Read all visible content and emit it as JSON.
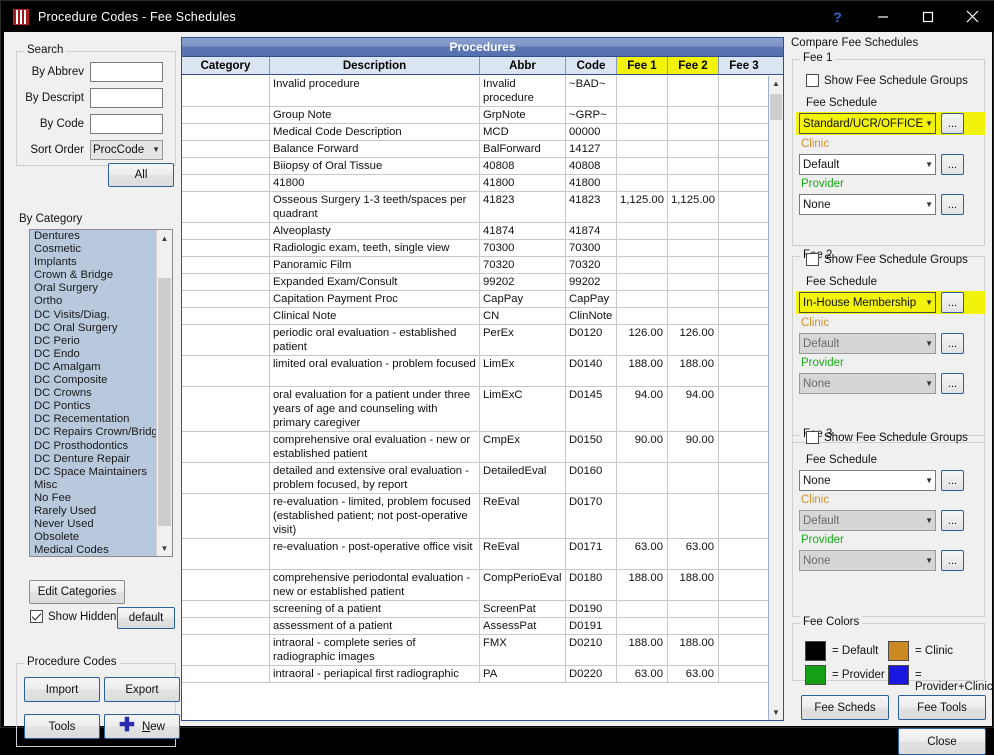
{
  "window": {
    "title": "Procedure Codes - Fee Schedules",
    "buttons": {
      "help": "?",
      "minimize": "minimize-icon",
      "maximize": "maximize-icon",
      "close": "close-icon"
    }
  },
  "search": {
    "legend": "Search",
    "by_abbrev_label": "By Abbrev",
    "by_abbrev_value": "",
    "by_descript_label": "By Descript",
    "by_descript_value": "",
    "by_code_label": "By Code",
    "by_code_value": "",
    "sort_order_label": "Sort Order",
    "sort_order_value": "ProcCode",
    "all_button": "All"
  },
  "category": {
    "label": "By Category",
    "items": [
      "Dentures",
      "Cosmetic",
      "Implants",
      "Crown & Bridge",
      "Oral Surgery",
      "Ortho",
      "DC Visits/Diag.",
      "DC Oral Surgery",
      "DC Perio",
      "DC Endo",
      "DC Amalgam",
      "DC Composite",
      "DC Crowns",
      "DC Pontics",
      "DC Recementation",
      "DC Repairs Crown/Bridg",
      "DC Prosthodontics",
      "DC Denture Repair",
      "DC Space Maintainers",
      "Misc",
      "No Fee",
      "Rarely Used",
      "Never Used",
      "Obsolete",
      "Medical Codes"
    ],
    "edit_categories_button": "Edit Categories",
    "show_hidden_label": "Show Hidden",
    "show_hidden_checked": true,
    "default_button": "default"
  },
  "procedure_codes_panel": {
    "legend": "Procedure Codes",
    "import_button": "Import",
    "export_button": "Export",
    "tools_button": "Tools",
    "new_button": "New"
  },
  "grid": {
    "title": "Procedures",
    "columns": [
      "Category",
      "Description",
      "Abbr",
      "Code",
      "Fee 1",
      "Fee 2",
      "Fee 3"
    ],
    "highlighted_columns": [
      "Fee 1",
      "Fee 2"
    ],
    "rows": [
      {
        "category": "",
        "description": "Invalid procedure",
        "abbr": "Invalid procedure",
        "code": "~BAD~",
        "fee1": "",
        "fee2": "",
        "fee3": "",
        "lines": 2
      },
      {
        "category": "",
        "description": "Group Note",
        "abbr": "GrpNote",
        "code": "~GRP~",
        "fee1": "",
        "fee2": "",
        "fee3": "",
        "lines": 1
      },
      {
        "category": "",
        "description": "Medical Code Description",
        "abbr": "MCD",
        "code": "00000",
        "fee1": "",
        "fee2": "",
        "fee3": "",
        "lines": 1
      },
      {
        "category": "",
        "description": "Balance Forward",
        "abbr": "BalForward",
        "code": "14127",
        "fee1": "",
        "fee2": "",
        "fee3": "",
        "lines": 1
      },
      {
        "category": "",
        "description": "Biiopsy of Oral Tissue",
        "abbr": "40808",
        "code": "40808",
        "fee1": "",
        "fee2": "",
        "fee3": "",
        "lines": 1
      },
      {
        "category": "",
        "description": "41800",
        "abbr": "41800",
        "code": "41800",
        "fee1": "",
        "fee2": "",
        "fee3": "",
        "lines": 1
      },
      {
        "category": "",
        "description": "Osseous Surgery 1-3 teeth/spaces per quadrant",
        "abbr": "41823",
        "code": "41823",
        "fee1": "1,125.00",
        "fee2": "1,125.00",
        "fee3": "",
        "lines": 2
      },
      {
        "category": "",
        "description": "Alveoplasty",
        "abbr": "41874",
        "code": "41874",
        "fee1": "",
        "fee2": "",
        "fee3": "",
        "lines": 1
      },
      {
        "category": "",
        "description": "Radiologic exam, teeth, single view",
        "abbr": "70300",
        "code": "70300",
        "fee1": "",
        "fee2": "",
        "fee3": "",
        "lines": 1
      },
      {
        "category": "",
        "description": "Panoramic Film",
        "abbr": "70320",
        "code": "70320",
        "fee1": "",
        "fee2": "",
        "fee3": "",
        "lines": 1
      },
      {
        "category": "",
        "description": "Expanded Exam/Consult",
        "abbr": "99202",
        "code": "99202",
        "fee1": "",
        "fee2": "",
        "fee3": "",
        "lines": 1
      },
      {
        "category": "",
        "description": "Capitation Payment Proc",
        "abbr": "CapPay",
        "code": "CapPay",
        "fee1": "",
        "fee2": "",
        "fee3": "",
        "lines": 1
      },
      {
        "category": "",
        "description": "Clinical Note",
        "abbr": "CN",
        "code": "ClinNote",
        "fee1": "",
        "fee2": "",
        "fee3": "",
        "lines": 1
      },
      {
        "category": "",
        "description": "periodic oral evaluation - established patient",
        "abbr": "PerEx",
        "code": "D0120",
        "fee1": "126.00",
        "fee2": "126.00",
        "fee3": "",
        "lines": 2
      },
      {
        "category": "",
        "description": "limited oral evaluation - problem focused",
        "abbr": "LimEx",
        "code": "D0140",
        "fee1": "188.00",
        "fee2": "188.00",
        "fee3": "",
        "lines": 2
      },
      {
        "category": "",
        "description": "oral evaluation for a patient under three years of age and counseling with primary caregiver",
        "abbr": "LimExC",
        "code": "D0145",
        "fee1": "94.00",
        "fee2": "94.00",
        "fee3": "",
        "lines": 3
      },
      {
        "category": "",
        "description": "comprehensive oral evaluation - new or established patient",
        "abbr": "CmpEx",
        "code": "D0150",
        "fee1": "90.00",
        "fee2": "90.00",
        "fee3": "",
        "lines": 2
      },
      {
        "category": "",
        "description": "detailed and extensive oral evaluation - problem focused, by report",
        "abbr": "DetailedEval",
        "code": "D0160",
        "fee1": "",
        "fee2": "",
        "fee3": "",
        "lines": 2
      },
      {
        "category": "",
        "description": "re-evaluation - limited, problem focused (established patient; not post-operative visit)",
        "abbr": "ReEval",
        "code": "D0170",
        "fee1": "",
        "fee2": "",
        "fee3": "",
        "lines": 3
      },
      {
        "category": "",
        "description": "re-evaluation - post-operative office visit",
        "abbr": "ReEval",
        "code": "D0171",
        "fee1": "63.00",
        "fee2": "63.00",
        "fee3": "",
        "lines": 2
      },
      {
        "category": "",
        "description": "comprehensive periodontal evaluation - new or established patient",
        "abbr": "CompPerioEval",
        "code": "D0180",
        "fee1": "188.00",
        "fee2": "188.00",
        "fee3": "",
        "lines": 2
      },
      {
        "category": "",
        "description": "screening of a patient",
        "abbr": "ScreenPat",
        "code": "D0190",
        "fee1": "",
        "fee2": "",
        "fee3": "",
        "lines": 1
      },
      {
        "category": "",
        "description": "assessment of a patient",
        "abbr": "AssessPat",
        "code": "D0191",
        "fee1": "",
        "fee2": "",
        "fee3": "",
        "lines": 1
      },
      {
        "category": "",
        "description": "intraoral - complete series of radiographic images",
        "abbr": "FMX",
        "code": "D0210",
        "fee1": "188.00",
        "fee2": "188.00",
        "fee3": "",
        "lines": 2
      },
      {
        "category": "",
        "description": "intraoral - periapical first radiographic",
        "abbr": "PA",
        "code": "D0220",
        "fee1": "63.00",
        "fee2": "63.00",
        "fee3": "",
        "lines": 1
      }
    ]
  },
  "compare": {
    "title": "Compare Fee Schedules",
    "groups": [
      {
        "legend": "Fee 1",
        "show_groups_label": "Show Fee Schedule Groups",
        "show_groups_checked": false,
        "fee_schedule_label": "Fee Schedule",
        "fee_schedule_value": "Standard/UCR/OFFICE FEE",
        "fee_schedule_highlighted": true,
        "clinic_label": "Clinic",
        "clinic_value": "Default",
        "clinic_disabled": false,
        "provider_label": "Provider",
        "provider_value": "None",
        "provider_disabled": false,
        "ellipsis": "..."
      },
      {
        "legend": "Fee 2",
        "show_groups_label": "Show Fee Schedule Groups",
        "show_groups_checked": false,
        "fee_schedule_label": "Fee Schedule",
        "fee_schedule_value": "In-House Membership",
        "fee_schedule_highlighted": true,
        "clinic_label": "Clinic",
        "clinic_value": "Default",
        "clinic_disabled": true,
        "provider_label": "Provider",
        "provider_value": "None",
        "provider_disabled": true,
        "ellipsis": "..."
      },
      {
        "legend": "Fee 3",
        "show_groups_label": "Show Fee Schedule Groups",
        "show_groups_checked": false,
        "fee_schedule_label": "Fee Schedule",
        "fee_schedule_value": "None",
        "fee_schedule_highlighted": false,
        "clinic_label": "Clinic",
        "clinic_value": "Default",
        "clinic_disabled": true,
        "provider_label": "Provider",
        "provider_value": "None",
        "provider_disabled": true,
        "ellipsis": "..."
      }
    ],
    "fee_colors": {
      "legend": "Fee Colors",
      "entries": [
        {
          "color": "#000000",
          "label": "= Default"
        },
        {
          "color": "#cc8822",
          "label": "= Clinic"
        },
        {
          "color": "#14a014",
          "label": "= Provider"
        },
        {
          "color": "#1a18e0",
          "label": "= Provider+Clinic"
        }
      ]
    },
    "fee_scheds_button": "Fee Scheds",
    "fee_tools_button": "Fee Tools",
    "close_button": "Close"
  }
}
